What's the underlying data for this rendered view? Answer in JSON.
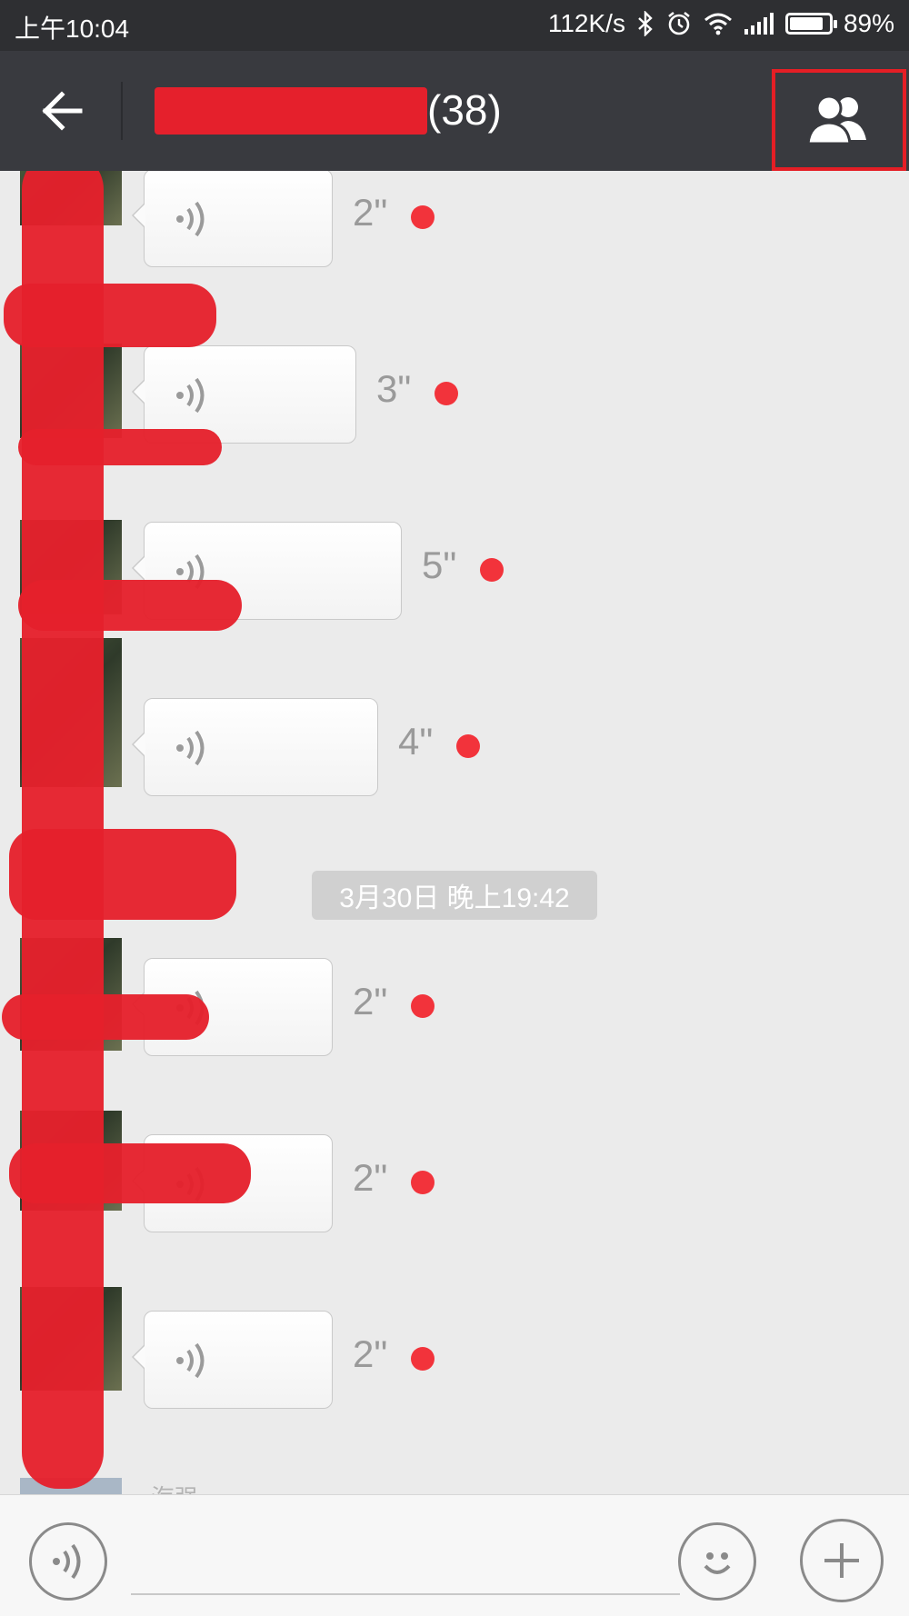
{
  "status_bar": {
    "time": "上午10:04",
    "network_speed": "112K/s",
    "battery_percent": "89%",
    "battery_level": 0.89,
    "icons": [
      "bluetooth-icon",
      "alarm-icon",
      "wifi-icon",
      "signal-icon",
      "battery-icon"
    ]
  },
  "header": {
    "member_count": "(38)",
    "back_icon": "arrow-left-icon",
    "members_icon": "group-members-icon"
  },
  "messages_before": [
    {
      "duration": "2\"",
      "unread": true
    },
    {
      "duration": "3\"",
      "unread": true
    },
    {
      "duration": "5\"",
      "unread": true
    },
    {
      "duration": "4\"",
      "unread": true
    }
  ],
  "timestamp": "3月30日 晚上19:42",
  "messages_after": [
    {
      "duration": "2\"",
      "unread": true
    },
    {
      "duration": "2\"",
      "unread": true
    },
    {
      "duration": "2\"",
      "unread": true
    }
  ],
  "partial_sender": "海强",
  "input_bar": {
    "voice_icon": "voice-mode-icon",
    "emoji_icon": "emoji-icon",
    "plus_icon": "plus-icon",
    "text_value": ""
  },
  "colors": {
    "header_bg": "#393a3f",
    "status_bg": "#2e2f32",
    "chat_bg": "#ebebeb",
    "unread_dot": "#f2333b",
    "highlight_box": "#e51e25"
  }
}
